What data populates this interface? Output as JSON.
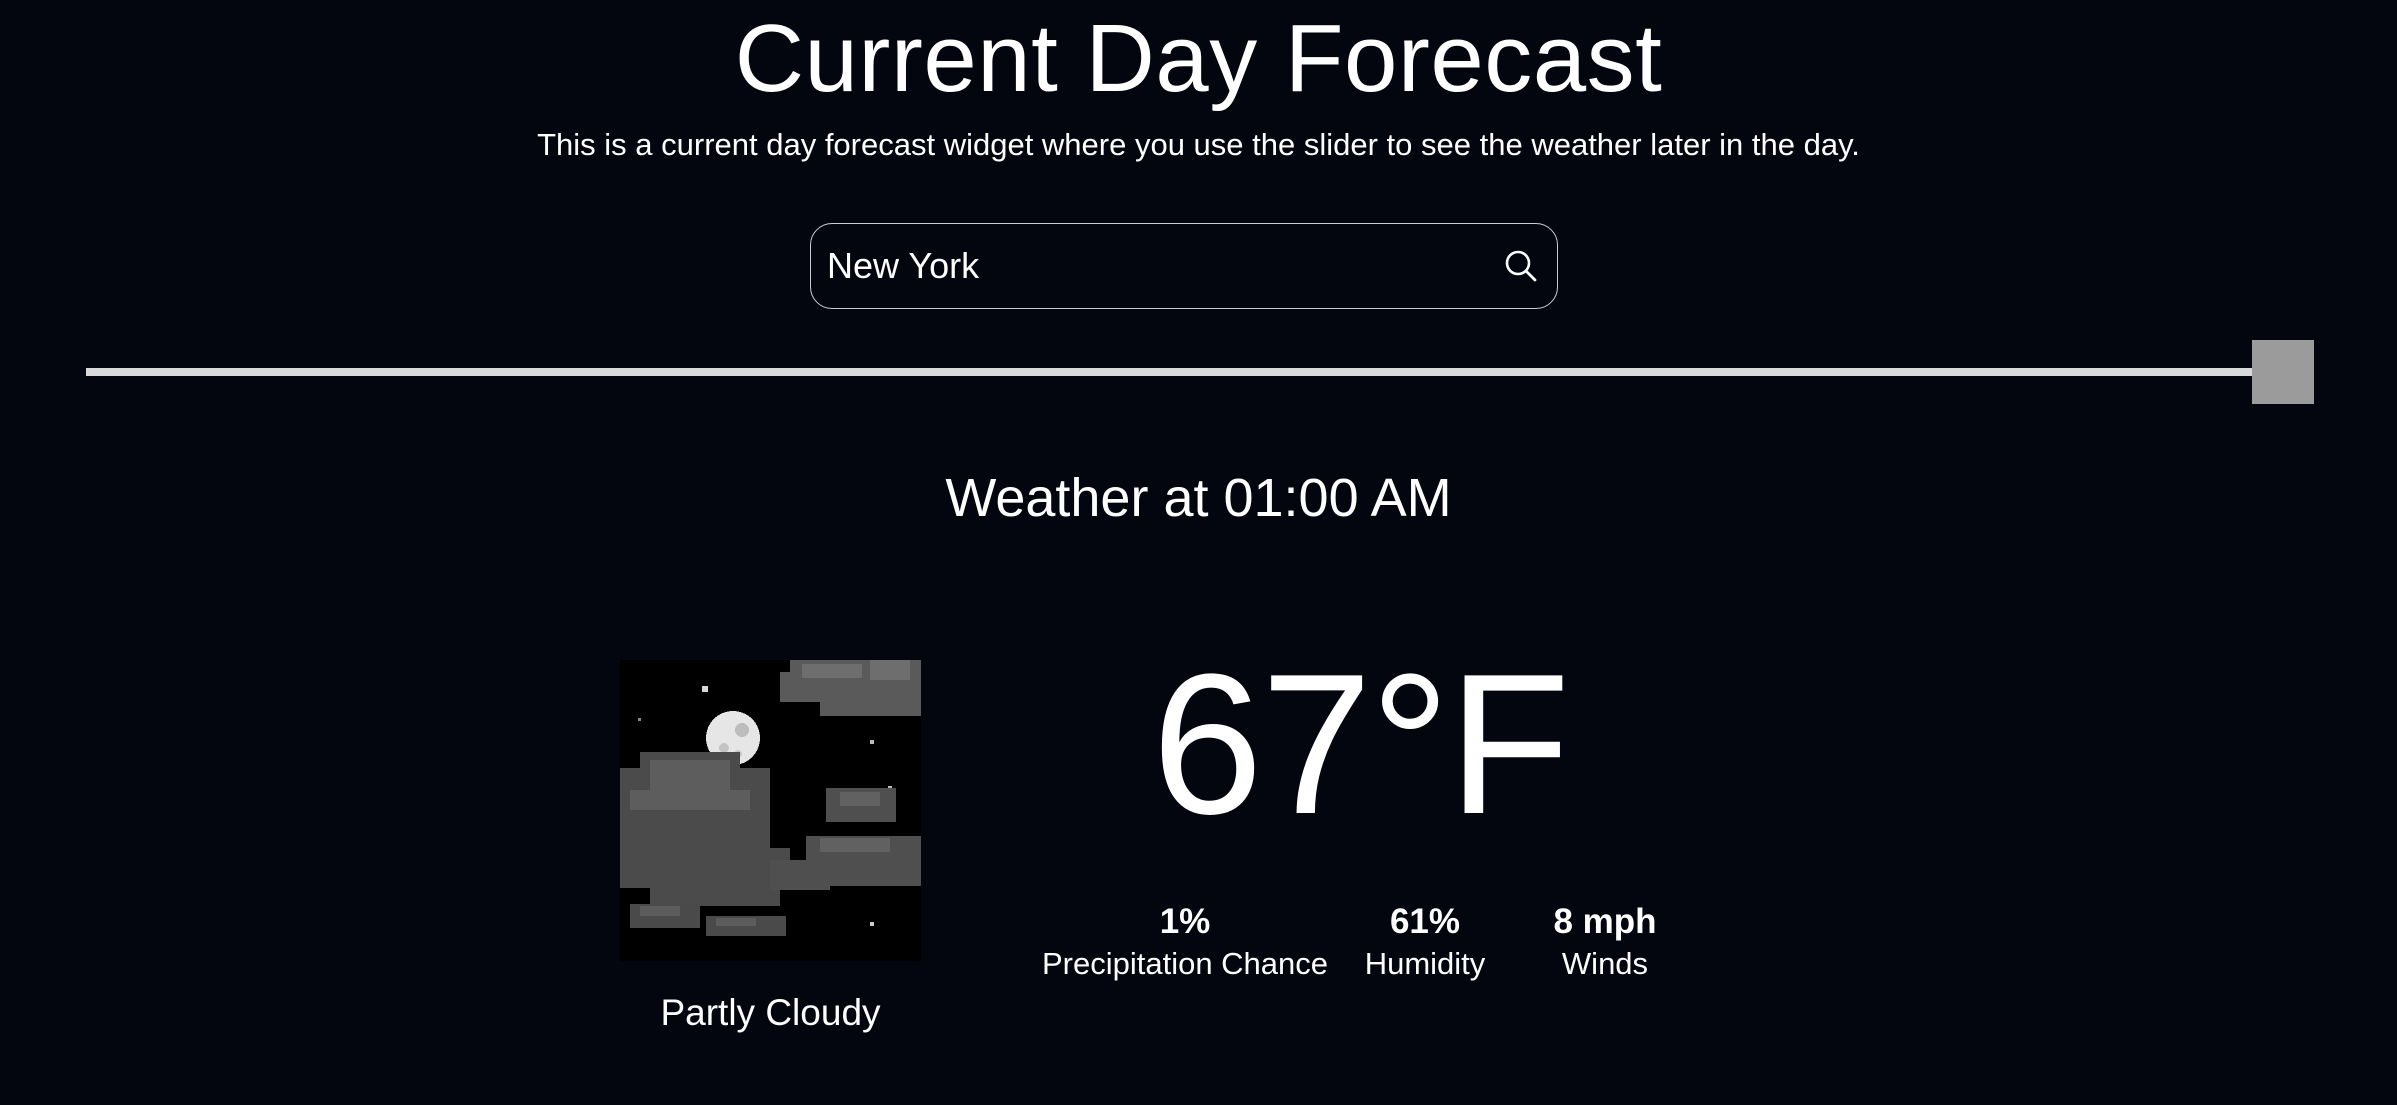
{
  "header": {
    "title": "Current Day Forecast",
    "subtitle": "This is a current day forecast widget where you use the slider to see the weather later in the day."
  },
  "search": {
    "value": "New York",
    "icon": "search-icon"
  },
  "slider": {
    "position_fraction": 0.986
  },
  "weather": {
    "time_label": "Weather at 01:00 AM",
    "condition": "Partly Cloudy",
    "condition_icon": "partly-cloudy-night-icon",
    "temperature": "67°F",
    "stats": [
      {
        "value": "1%",
        "label": "Precipitation Chance"
      },
      {
        "value": "61%",
        "label": "Humidity"
      },
      {
        "value": "8 mph",
        "label": "Winds"
      }
    ]
  },
  "colors": {
    "background": "#03060f",
    "text": "#ffffff",
    "slider_track": "#cfcfcf",
    "slider_thumb": "#9b9b9b"
  }
}
